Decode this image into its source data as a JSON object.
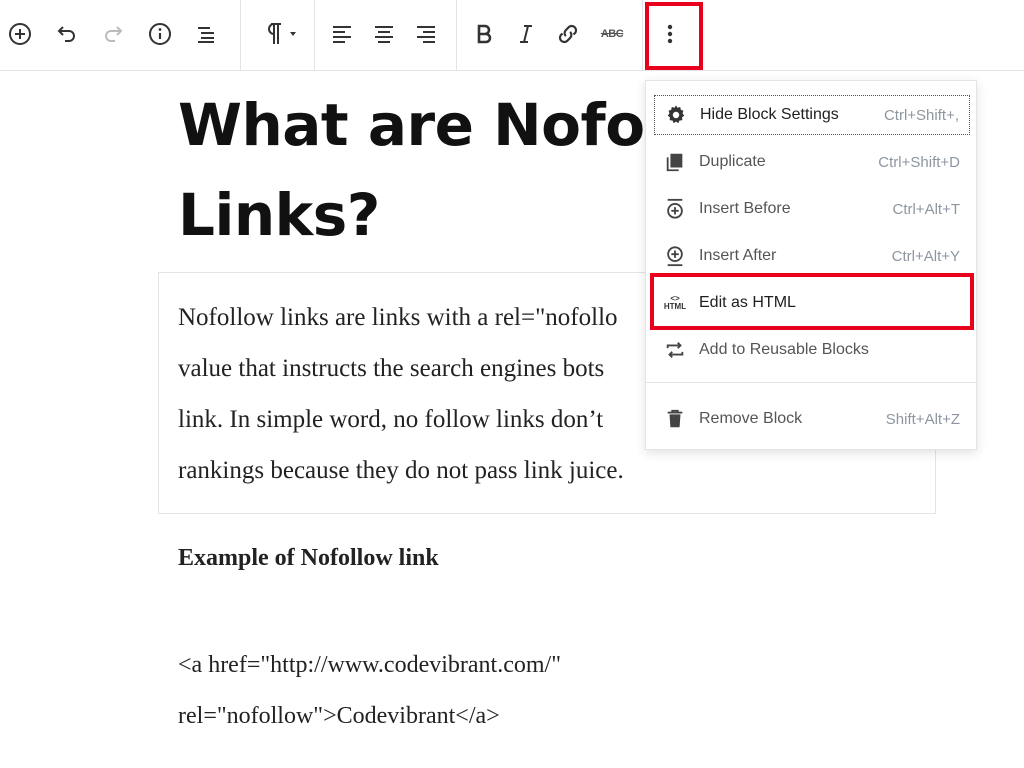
{
  "toolbar": {
    "buttons": [
      "add-block",
      "undo",
      "redo",
      "content-info",
      "block-navigation",
      "paragraph",
      "align-left",
      "align-center",
      "align-right",
      "bold",
      "italic",
      "link",
      "strikethrough",
      "more-options"
    ],
    "strikethrough_label": "ABC",
    "highlight_color": "#e8001c"
  },
  "content": {
    "title_lines": [
      "What are Nofo",
      "Links?"
    ],
    "paragraph_lines": [
      "Nofollow links are links with a rel=\"nofollo",
      "value that instructs the search engines bots",
      "link. In simple word, no follow links don’t",
      "rankings because they do not pass link juice."
    ],
    "example_heading": "Example of Nofollow link",
    "code_lines": [
      "<a href=\"http://www.codevibrant.com/\"",
      "rel=\"nofollow\">Codevibrant</a>"
    ]
  },
  "menu": {
    "items": [
      {
        "label": "Hide Block Settings",
        "shortcut": "Ctrl+Shift+,",
        "icon": "gear-icon"
      },
      {
        "label": "Duplicate",
        "shortcut": "Ctrl+Shift+D",
        "icon": "duplicate-icon"
      },
      {
        "label": "Insert Before",
        "shortcut": "Ctrl+Alt+T",
        "icon": "insert-before-icon"
      },
      {
        "label": "Insert After",
        "shortcut": "Ctrl+Alt+Y",
        "icon": "insert-after-icon"
      },
      {
        "label": "Edit as HTML",
        "shortcut": "",
        "icon": "html-icon"
      },
      {
        "label": "Add to Reusable Blocks",
        "shortcut": "",
        "icon": "reusable-icon"
      },
      {
        "label": "Remove Block",
        "shortcut": "Shift+Alt+Z",
        "icon": "trash-icon"
      }
    ],
    "html_icon_text": [
      "<>",
      "HTML"
    ]
  }
}
